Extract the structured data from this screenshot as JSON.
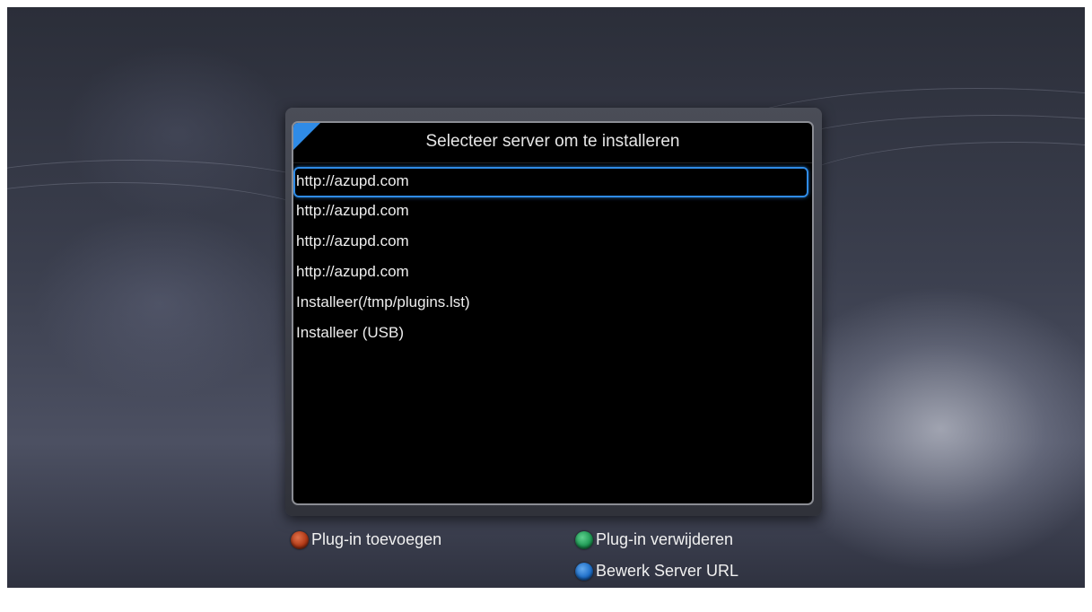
{
  "dialog": {
    "title": "Selecteer server om te installeren",
    "items": [
      {
        "label": "http://azupd.com"
      },
      {
        "label": "http://azupd.com"
      },
      {
        "label": "http://azupd.com"
      },
      {
        "label": "http://azupd.com"
      },
      {
        "label": "Installeer(/tmp/plugins.lst)"
      },
      {
        "label": "Installeer (USB)"
      }
    ],
    "selected_index": 0
  },
  "keys": {
    "red": {
      "label": "Plug-in toevoegen",
      "color": "#c2411c",
      "icon": "red-key-icon"
    },
    "green": {
      "label": "Plug-in verwijderen",
      "color": "#1f9a55",
      "icon": "green-key-icon"
    },
    "blue": {
      "label": "Bewerk Server URL",
      "color": "#1e6fc9",
      "icon": "blue-key-icon"
    }
  },
  "colors": {
    "accent": "#2f8be6",
    "panel": "#000000"
  }
}
